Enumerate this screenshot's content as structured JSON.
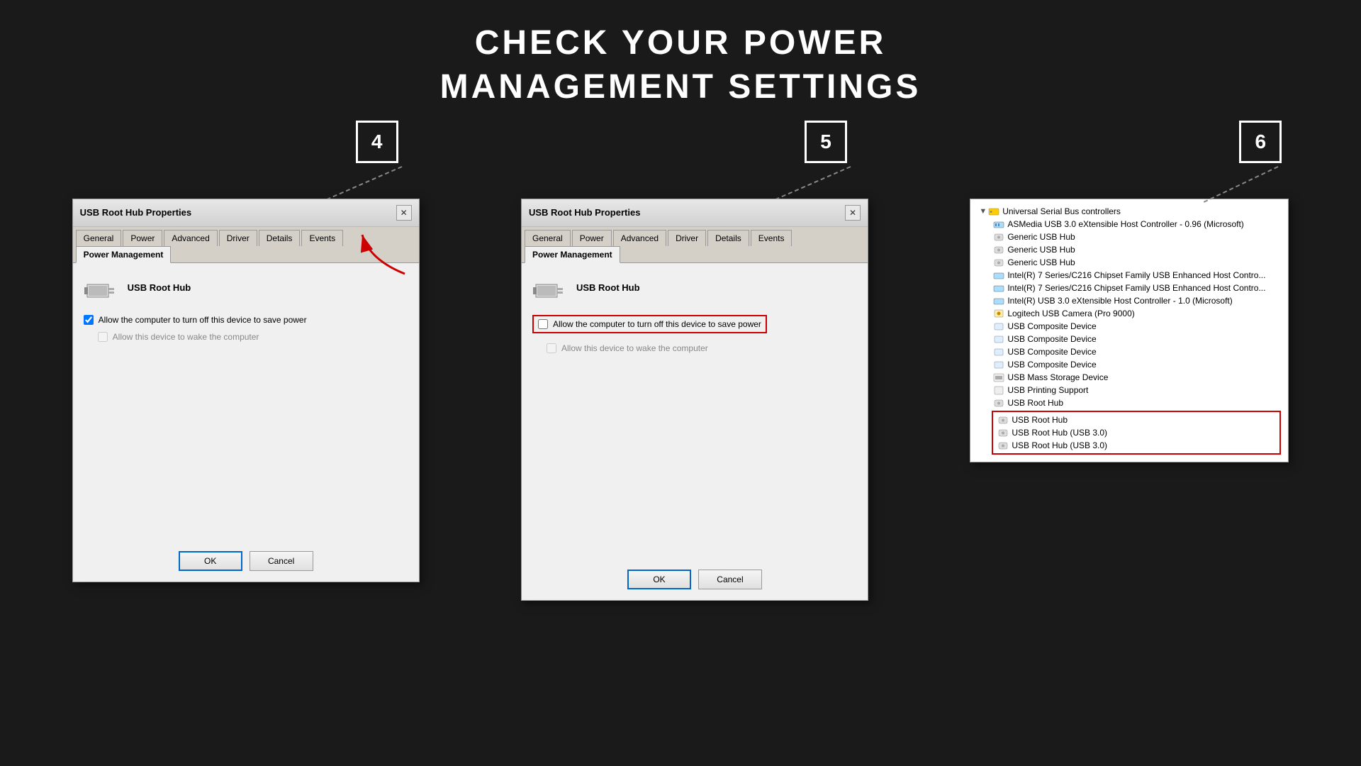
{
  "page": {
    "title_line1": "CHECK YOUR POWER",
    "title_line2": "MANAGEMENT SETTINGS"
  },
  "steps": [
    {
      "number": "4",
      "dialog": {
        "title": "USB Root Hub Properties",
        "tabs": [
          "General",
          "Power",
          "Advanced",
          "Driver",
          "Details",
          "Events",
          "Power Management"
        ],
        "active_tab": "Power Management",
        "device_name": "USB Root Hub",
        "checkbox1_label": "Allow the computer to turn off this device to save power",
        "checkbox1_checked": true,
        "checkbox2_label": "Allow this device to wake the computer",
        "checkbox2_checked": false,
        "checkbox2_disabled": true,
        "ok_label": "OK",
        "cancel_label": "Cancel"
      }
    },
    {
      "number": "5",
      "dialog": {
        "title": "USB Root Hub Properties",
        "tabs": [
          "General",
          "Power",
          "Advanced",
          "Driver",
          "Details",
          "Events",
          "Power Management"
        ],
        "active_tab": "Power Management",
        "device_name": "USB Root Hub",
        "checkbox1_label": "Allow the computer to turn off this device to save power",
        "checkbox1_checked": false,
        "checkbox1_highlighted": true,
        "checkbox2_label": "Allow this device to wake the computer",
        "checkbox2_checked": false,
        "checkbox2_disabled": true,
        "ok_label": "OK",
        "cancel_label": "Cancel"
      }
    },
    {
      "number": "6",
      "device_manager": {
        "title": "Universal Serial Bus controllers",
        "items": [
          "ASMedia USB 3.0 eXtensible Host Controller - 0.96 (Microsoft)",
          "Generic USB Hub",
          "Generic USB Hub",
          "Generic USB Hub",
          "Intel(R) 7 Series/C216 Chipset Family USB Enhanced Host Contro...",
          "Intel(R) 7 Series/C216 Chipset Family USB Enhanced Host Contro...",
          "Intel(R) USB 3.0 eXtensible Host Controller - 1.0 (Microsoft)",
          "Logitech USB Camera (Pro 9000)",
          "USB Composite Device",
          "USB Composite Device",
          "USB Composite Device",
          "USB Composite Device",
          "USB Mass Storage Device",
          "USB Printing Support",
          "USB Root Hub"
        ],
        "highlighted_items": [
          "USB Root Hub",
          "USB Root Hub (USB 3.0)",
          "USB Root Hub (USB 3.0)"
        ]
      }
    }
  ]
}
